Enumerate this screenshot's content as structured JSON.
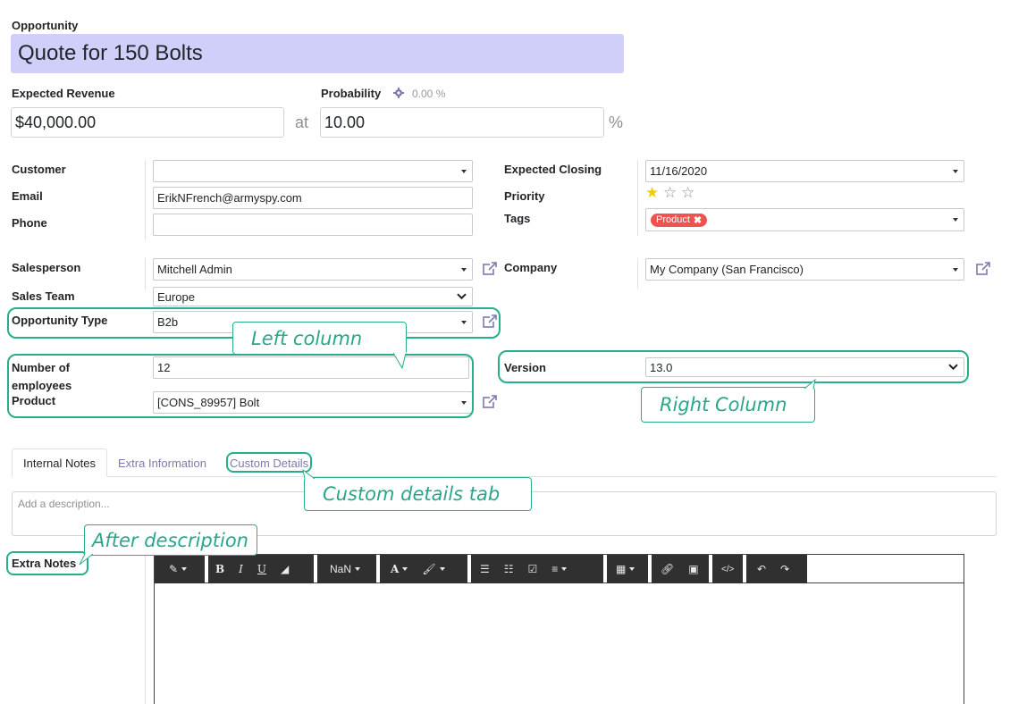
{
  "opportunity": {
    "label": "Opportunity",
    "title": "Quote for 150 Bolts"
  },
  "revenue": {
    "label": "Expected Revenue",
    "value": "$40,000.00",
    "at": "at"
  },
  "probability": {
    "label": "Probability",
    "computed": "0.00 %",
    "value": "10.00",
    "percent": "%"
  },
  "left": {
    "customer": {
      "label": "Customer",
      "value": ""
    },
    "email": {
      "label": "Email",
      "value": "ErikNFrench@armyspy.com"
    },
    "phone": {
      "label": "Phone",
      "value": ""
    },
    "salesperson": {
      "label": "Salesperson",
      "value": "Mitchell Admin"
    },
    "sales_team": {
      "label": "Sales Team",
      "value": "Europe"
    },
    "opp_type": {
      "label": "Opportunity Type",
      "value": "B2b"
    },
    "employees": {
      "label": "Number of employees",
      "value": "12"
    },
    "product": {
      "label": "Product",
      "value": "[CONS_89957] Bolt"
    }
  },
  "right": {
    "expected_closing": {
      "label": "Expected Closing",
      "value": "11/16/2020"
    },
    "priority": {
      "label": "Priority",
      "value": 1,
      "max": 3
    },
    "tags": {
      "label": "Tags",
      "tag": "Product"
    },
    "company": {
      "label": "Company",
      "value": "My Company (San Francisco)"
    },
    "version": {
      "label": "Version",
      "value": "13.0"
    }
  },
  "tabs": [
    "Internal Notes",
    "Extra Information",
    "Custom Details"
  ],
  "description": {
    "placeholder": "Add a description..."
  },
  "extra_notes": {
    "label": "Extra Notes"
  },
  "toolbar": {
    "font_size": "NaN"
  },
  "callouts": {
    "left_column": "Left column",
    "right_column": "Right Column",
    "custom_tab": "Custom details tab",
    "after_description": "After description"
  },
  "colors": {
    "highlight": "#27ae8c",
    "title_bg": "#cfcff9",
    "tag": "#ef5350",
    "star": "#f3cc00",
    "toolbar": "#303030"
  }
}
